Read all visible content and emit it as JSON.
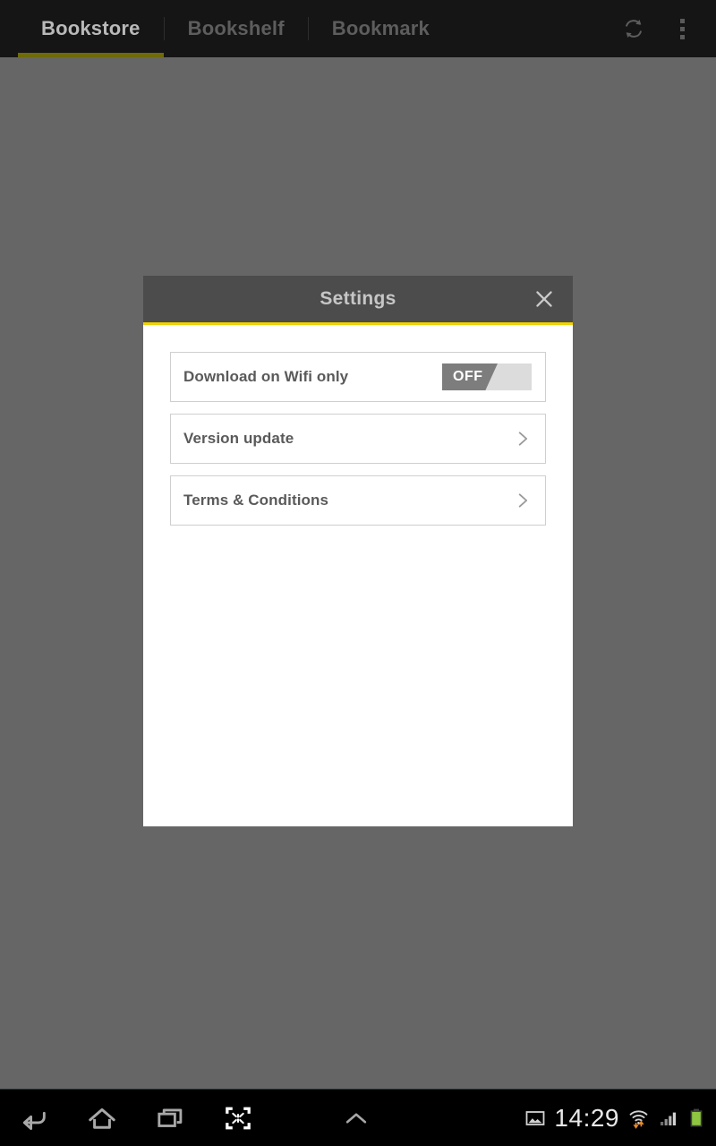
{
  "topbar": {
    "tabs": [
      {
        "label": "Bookstore",
        "active": true
      },
      {
        "label": "Bookshelf",
        "active": false
      },
      {
        "label": "Bookmark",
        "active": false
      }
    ],
    "actions": [
      {
        "name": "refresh-icon",
        "label": "Refresh"
      },
      {
        "name": "overflow-menu-icon",
        "label": "More options"
      }
    ],
    "accent_color": "#6e6b08",
    "background_color": "#151515",
    "active_tab_text_color": "#b9b9b9",
    "inactive_tab_text_color": "#5d5d5d"
  },
  "scrim": {
    "color": "#666666"
  },
  "dialog": {
    "title": "Settings",
    "close_label": "✕",
    "header_color": "#4c4c4c",
    "accent_line_color": "#f2d200",
    "body_color": "#ffffff",
    "rows": [
      {
        "label": "Download on Wifi only",
        "control": "toggle",
        "toggle_state": "OFF",
        "toggle_on_color": "#7d7d7d",
        "toggle_track_color": "#dcdcdc"
      },
      {
        "label": "Version update",
        "control": "chevron",
        "toggle_state": "",
        "toggle_on_color": "",
        "toggle_track_color": ""
      },
      {
        "label": "Terms & Conditions",
        "control": "chevron",
        "toggle_state": "",
        "toggle_on_color": "",
        "toggle_track_color": ""
      }
    ]
  },
  "systembar": {
    "nav": [
      {
        "name": "back-icon",
        "label": "Back"
      },
      {
        "name": "home-icon",
        "label": "Home"
      },
      {
        "name": "recents-icon",
        "label": "Recent apps"
      },
      {
        "name": "screenshot-icon",
        "label": "Screenshot"
      },
      {
        "name": "expand-up-icon",
        "label": "Show navigation"
      }
    ],
    "status": {
      "screenshot_notification_icon": "image-icon",
      "time": "14:29",
      "wifi_icon": "wifi-icon",
      "signal_icon": "cellular-signal-icon",
      "battery_icon": "battery-full-icon",
      "battery_color": "#8ec63f",
      "wifi_arrow_color": "#e8892a"
    }
  }
}
